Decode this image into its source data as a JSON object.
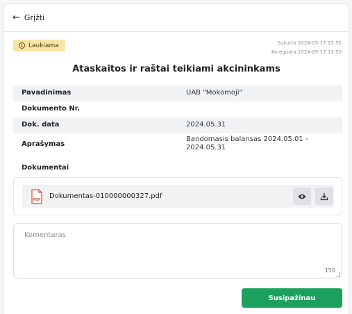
{
  "header": {
    "back_label": "Grįžti"
  },
  "status": {
    "label": "Laukiama",
    "color": "#f8e5a5"
  },
  "meta": {
    "created": "Sukurta 2024-05-17 13:50",
    "updated": "Koreguota 2024-05-17 13:50"
  },
  "title": "Ataskaitos ir raštai teikiami akcininkams",
  "fields": [
    {
      "label": "Pavadinimas",
      "value": "UAB \"Mokomoji\""
    },
    {
      "label": "Dokumento Nr.",
      "value": ""
    },
    {
      "label": "Dok. data",
      "value": "2024.05.31"
    },
    {
      "label": "Aprašymas",
      "value_line1": "Bandomasis balansas 2024.05.01 -",
      "value_line2": "2024.05.31"
    }
  ],
  "documents": {
    "label": "Dokumentai",
    "items": [
      {
        "icon_label": "PDF",
        "filename": "Dokumentas-010000000327.pdf",
        "view_icon": "eye-icon",
        "download_icon": "download-icon"
      }
    ]
  },
  "comment": {
    "placeholder": "Komentaras",
    "remaining": "150"
  },
  "actions": {
    "submit_label": "Susipažinau",
    "accent": "#1ba05e"
  }
}
